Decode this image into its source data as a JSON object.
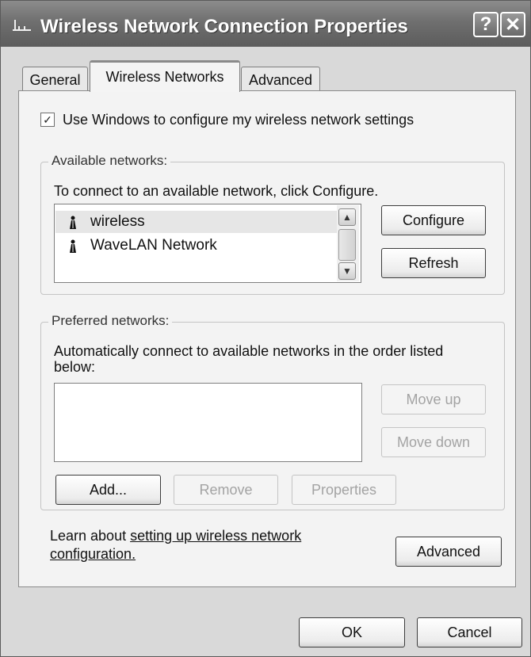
{
  "window": {
    "title": "Wireless Network Connection Properties",
    "help_label": "?",
    "close_label": "✕"
  },
  "tabs": [
    {
      "label": "General",
      "selected": false
    },
    {
      "label": "Wireless Networks",
      "selected": true
    },
    {
      "label": "Advanced",
      "selected": false
    }
  ],
  "use_windows_checkbox": {
    "label": "Use Windows to configure my wireless network settings",
    "checked": true,
    "mark": "✓"
  },
  "available": {
    "title": "Available networks:",
    "hint": "To connect to an available network, click Configure.",
    "items": [
      {
        "label": "wireless",
        "icon": "antenna-icon"
      },
      {
        "label": "WaveLAN Network",
        "icon": "antenna-icon"
      }
    ],
    "configure_label": "Configure",
    "refresh_label": "Refresh"
  },
  "preferred": {
    "title": "Preferred networks:",
    "description": "Automatically connect to available networks in the order listed below:",
    "move_up_label": "Move up",
    "move_down_label": "Move down",
    "add_label": "Add...",
    "remove_label": "Remove",
    "properties_label": "Properties"
  },
  "footer": {
    "learn_prefix": "Learn about ",
    "learn_link_1": "setting up wireless network",
    "learn_link_2": "configuration.",
    "advanced_label": "Advanced",
    "ok_label": "OK",
    "cancel_label": "Cancel"
  }
}
